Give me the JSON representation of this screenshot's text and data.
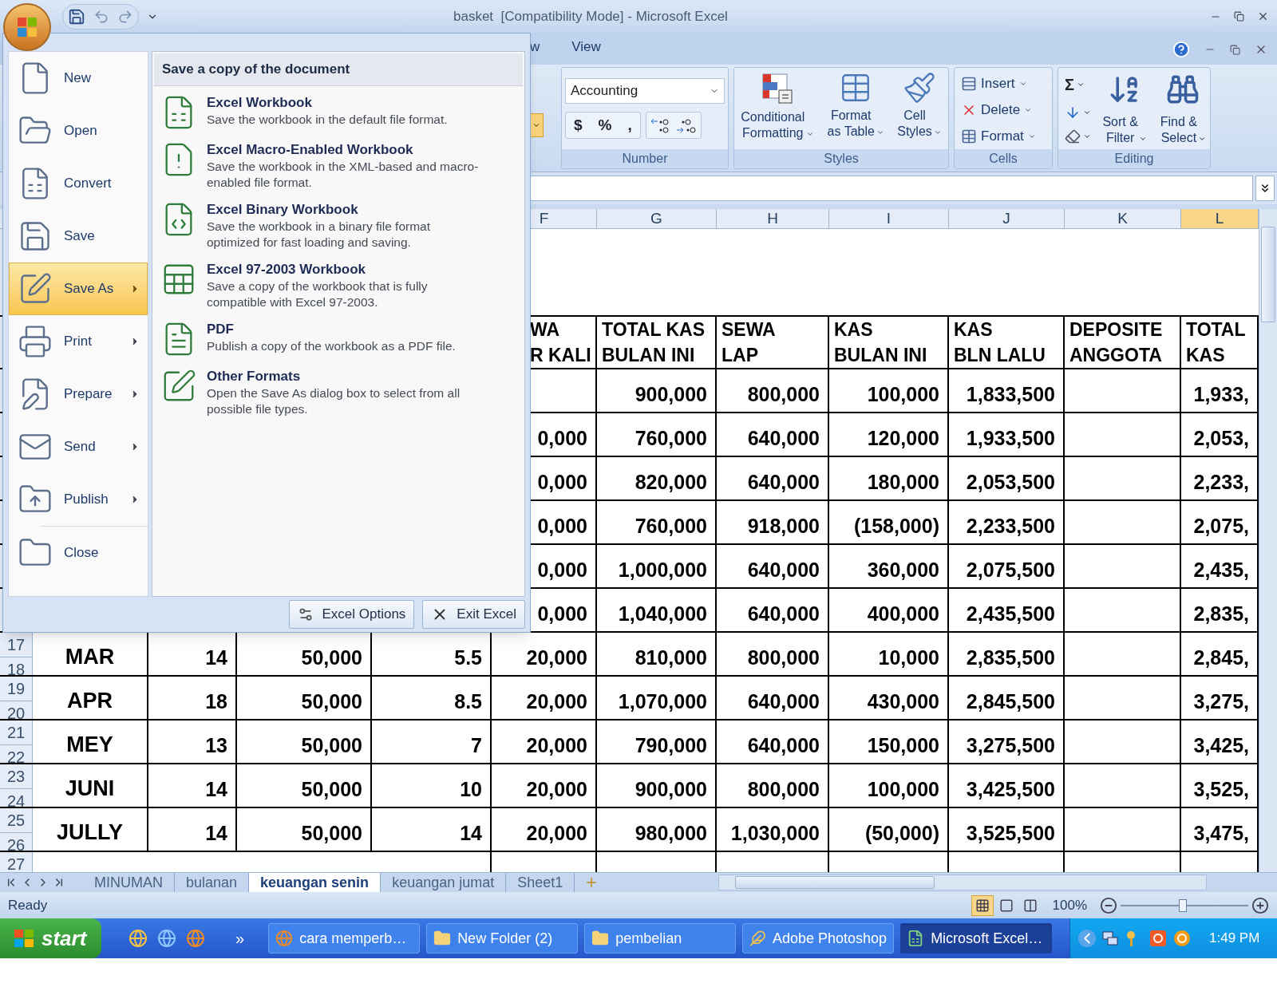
{
  "window": {
    "title": "basket  [Compatibility Mode] - Microsoft Excel"
  },
  "ribbon": {
    "tabs": [
      {
        "label": "w",
        "selected": false
      },
      {
        "label": "View",
        "selected": false
      }
    ],
    "number_group": {
      "label": "Number",
      "format": "Accounting",
      "buttons": [
        "$",
        "%",
        ","
      ]
    },
    "styles_group": {
      "label": "Styles",
      "buttons": [
        {
          "lines": [
            "Conditional",
            "Formatting"
          ]
        },
        {
          "lines": [
            "Format",
            "as Table"
          ]
        },
        {
          "lines": [
            "Cell",
            "Styles"
          ]
        }
      ]
    },
    "cells_group": {
      "label": "Cells",
      "buttons": [
        "Insert",
        "Delete",
        "Format"
      ]
    },
    "editing_group": {
      "label": "Editing",
      "sum": "Σ",
      "buttons": [
        {
          "lines": [
            "Sort &",
            "Filter"
          ]
        },
        {
          "lines": [
            "Find &",
            "Select"
          ]
        }
      ]
    }
  },
  "office_menu": {
    "commands": [
      {
        "label": "New",
        "kind": "plain",
        "selected": false
      },
      {
        "label": "Open",
        "kind": "plain",
        "selected": false
      },
      {
        "label": "Convert",
        "kind": "plain",
        "selected": false
      },
      {
        "label": "Save",
        "kind": "plain",
        "selected": false
      },
      {
        "label": "Save As",
        "kind": "submenu",
        "selected": true
      },
      {
        "label": "Print",
        "kind": "submenu",
        "selected": false
      },
      {
        "label": "Prepare",
        "kind": "submenu",
        "selected": false
      },
      {
        "label": "Send",
        "kind": "submenu",
        "selected": false
      },
      {
        "label": "Publish",
        "kind": "submenu",
        "selected": false
      },
      {
        "label": "Close",
        "kind": "plain",
        "selected": false
      }
    ],
    "panel": {
      "heading": "Save a copy of the document",
      "options": [
        {
          "title": "Excel Workbook",
          "description": "Save the workbook in the default file format."
        },
        {
          "title": "Excel Macro-Enabled Workbook",
          "description": "Save the workbook in the XML-based and macro-enabled file format."
        },
        {
          "title": "Excel Binary Workbook",
          "description": "Save the workbook in a binary file format optimized for fast loading and saving."
        },
        {
          "title": "Excel 97-2003 Workbook",
          "description": "Save a copy of the workbook that is fully compatible with Excel 97-2003."
        },
        {
          "title": "PDF",
          "description": "Publish a copy of the workbook as a PDF file."
        },
        {
          "title": "Other Formats",
          "description": "Open the Save As dialog box to select from all possible file types."
        }
      ]
    },
    "buttons": [
      "Excel Options",
      "Exit Excel"
    ]
  },
  "sheet": {
    "columns": [
      {
        "letter": "F",
        "selected": false
      },
      {
        "letter": "G",
        "selected": false
      },
      {
        "letter": "H",
        "selected": false
      },
      {
        "letter": "I",
        "selected": false
      },
      {
        "letter": "J",
        "selected": false
      },
      {
        "letter": "K",
        "selected": false
      },
      {
        "letter": "L",
        "selected": true
      }
    ],
    "heading_row": [
      [
        "WA",
        "R KALI"
      ],
      [
        "TOTAL KAS",
        "BULAN INI"
      ],
      [
        "SEWA",
        "LAP"
      ],
      [
        "KAS",
        "BULAN INI"
      ],
      [
        "KAS",
        "BLN LALU"
      ],
      [
        "DEPOSITE",
        "ANGGOTA"
      ],
      [
        "TOTAL",
        "KAS"
      ]
    ],
    "rows": [
      {
        "cells": [
          null,
          "900,000",
          "800,000",
          "100,000",
          "1,833,500",
          null,
          "1,933,"
        ]
      },
      {
        "cells": [
          "0,000",
          "760,000",
          "640,000",
          "120,000",
          "1,933,500",
          null,
          "2,053,"
        ]
      },
      {
        "cells": [
          "0,000",
          "820,000",
          "640,000",
          "180,000",
          "2,053,500",
          null,
          "2,233,"
        ]
      },
      {
        "cells": [
          "0,000",
          "760,000",
          "918,000",
          "(158,000)",
          "2,233,500",
          null,
          "2,075,"
        ]
      },
      {
        "cells": [
          "0,000",
          "1,000,000",
          "640,000",
          "360,000",
          "2,075,500",
          null,
          "2,435,"
        ]
      },
      {
        "cells": [
          "0,000",
          "1,040,000",
          "640,000",
          "400,000",
          "2,435,500",
          null,
          "2,835,"
        ]
      },
      {
        "row_numbers": [
          "17",
          "18"
        ],
        "cells": [
          "MAR",
          "14",
          "50,000",
          "5.5",
          "20,000",
          "810,000",
          "800,000",
          "10,000",
          "2,835,500",
          null,
          "2,845,"
        ]
      },
      {
        "row_numbers": [
          "19",
          "20"
        ],
        "cells": [
          "APR",
          "18",
          "50,000",
          "8.5",
          "20,000",
          "1,070,000",
          "640,000",
          "430,000",
          "2,845,500",
          null,
          "3,275,"
        ]
      },
      {
        "row_numbers": [
          "21",
          "22"
        ],
        "cells": [
          "MEY",
          "13",
          "50,000",
          "7",
          "20,000",
          "790,000",
          "640,000",
          "150,000",
          "3,275,500",
          null,
          "3,425,"
        ]
      },
      {
        "row_numbers": [
          "23",
          "24"
        ],
        "cells": [
          "JUNI",
          "14",
          "50,000",
          "10",
          "20,000",
          "900,000",
          "800,000",
          "100,000",
          "3,425,500",
          null,
          "3,525,"
        ]
      },
      {
        "row_numbers": [
          "25",
          "26"
        ],
        "cells": [
          "JULLY",
          "14",
          "50,000",
          "14",
          "20,000",
          "980,000",
          "1,030,000",
          "(50,000)",
          "3,525,500",
          null,
          "3,475,"
        ]
      },
      {
        "row_numbers": [
          "27"
        ]
      }
    ],
    "tabs": [
      {
        "label": "MINUMAN",
        "selected": false
      },
      {
        "label": "bulanan",
        "selected": false
      },
      {
        "label": "keuangan senin",
        "selected": true
      },
      {
        "label": "keuangan jumat",
        "selected": false
      },
      {
        "label": "Sheet1",
        "selected": false
      }
    ]
  },
  "status_bar": {
    "text": "Ready",
    "views": [
      {
        "kind": "normal",
        "selected": true
      },
      {
        "kind": "page_layout",
        "selected": false
      },
      {
        "kind": "page_break",
        "selected": false
      }
    ],
    "zoom": "100%",
    "zoom_level": {
      "level": 0.49
    }
  },
  "taskbar": {
    "start": "start",
    "more": "»",
    "tasks": [
      {
        "label": "cara memperb…",
        "kind": "browser",
        "selected": false
      },
      {
        "label": "New Folder (2)",
        "kind": "folder",
        "selected": false
      },
      {
        "label": "pembelian",
        "kind": "folder",
        "selected": false
      },
      {
        "label": "Adobe Photoshop",
        "kind": "editor",
        "selected": false
      },
      {
        "label": "Microsoft Excel…",
        "kind": "spreadsheet",
        "selected": true
      }
    ],
    "time": "1:49 PM"
  }
}
